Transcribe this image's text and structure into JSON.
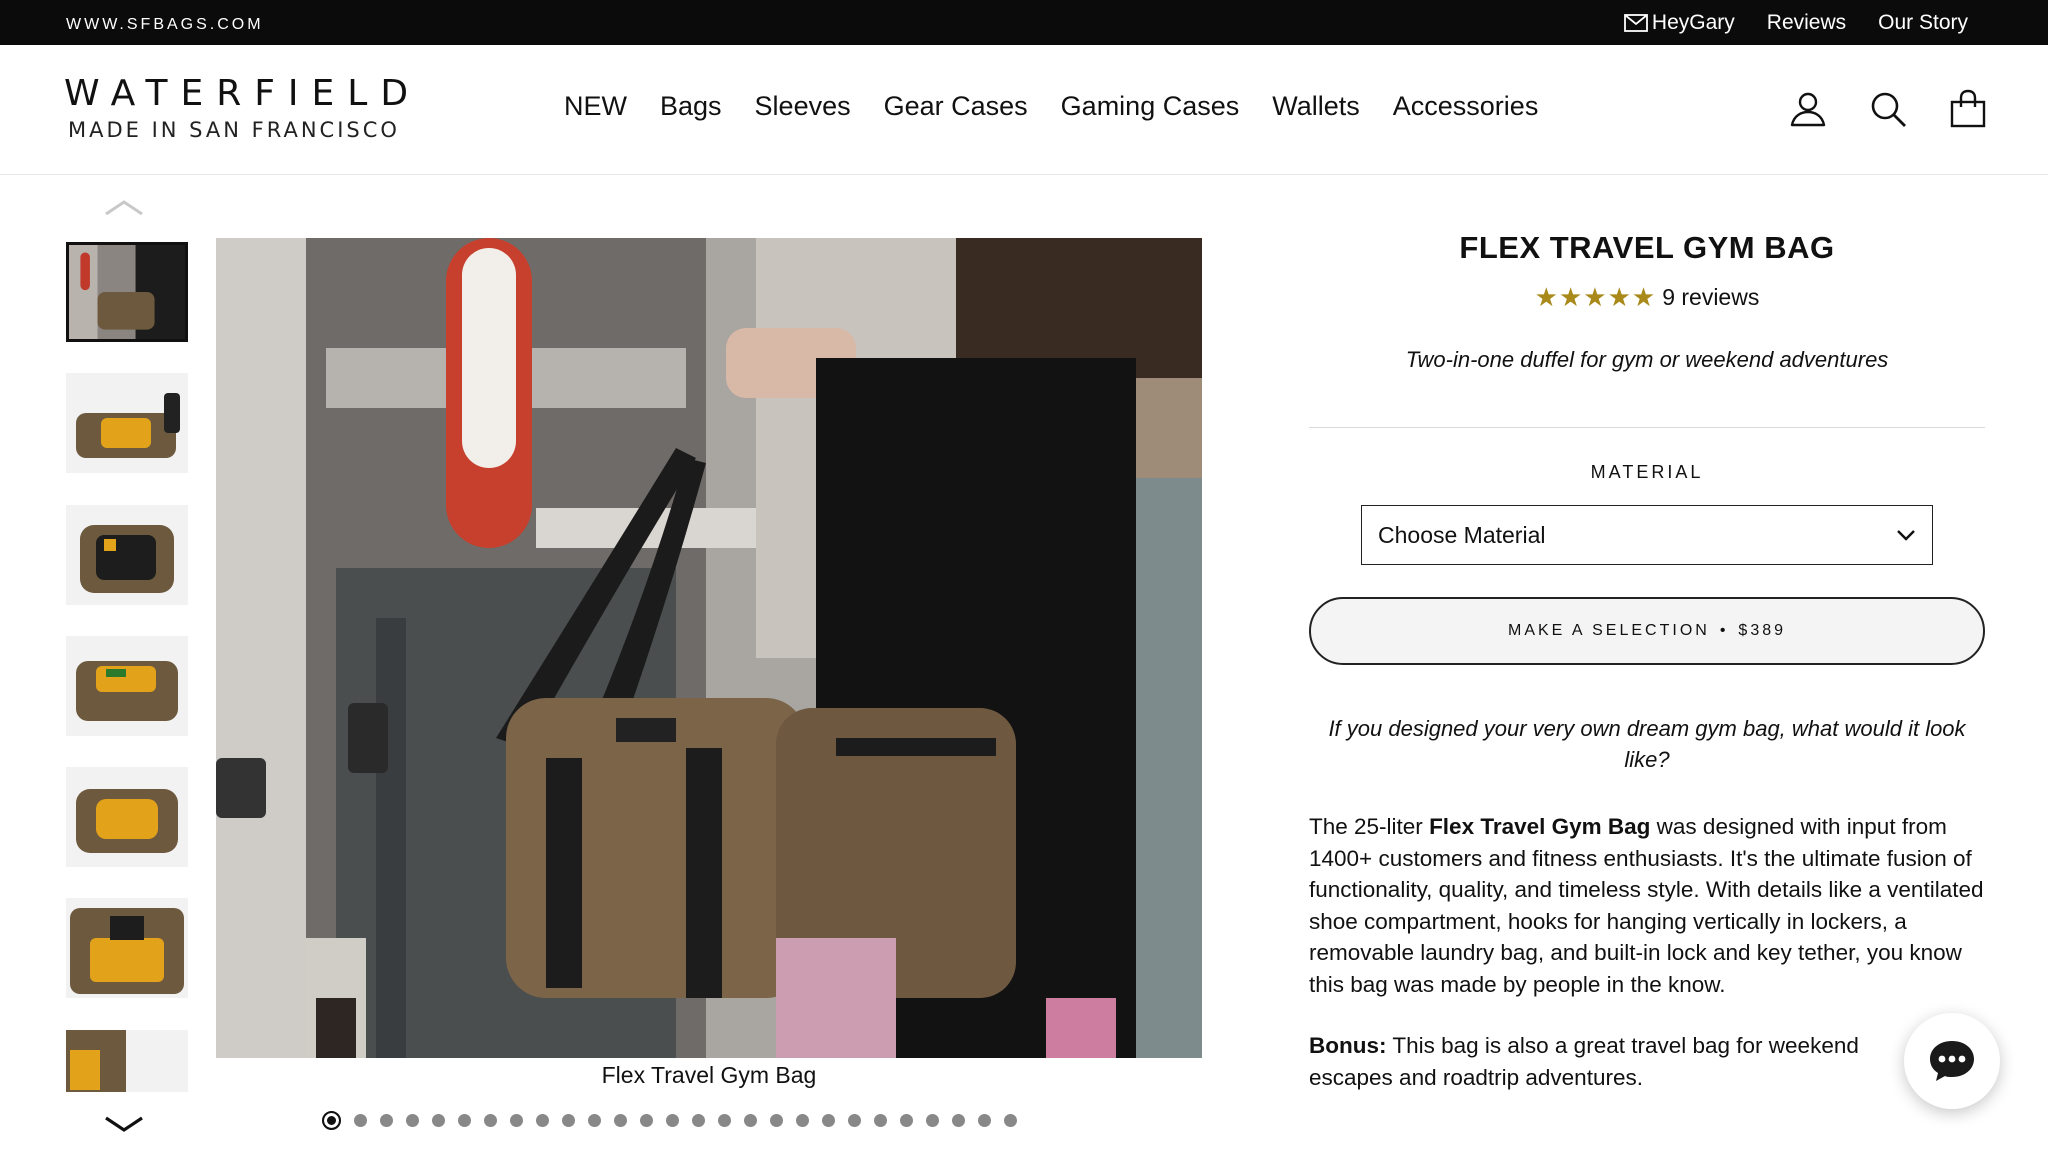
{
  "topbar": {
    "site": "WWW.SFBAGS.COM",
    "links": [
      "HeyGary",
      "Reviews",
      "Our Story"
    ]
  },
  "header": {
    "brand": "WATERFIELD",
    "tagline": "MADE IN SAN FRANCISCO",
    "nav": [
      "NEW",
      "Bags",
      "Sleeves",
      "Gear Cases",
      "Gaming Cases",
      "Wallets",
      "Accessories"
    ],
    "icons": [
      "account-icon",
      "search-icon",
      "cart-icon"
    ]
  },
  "gallery": {
    "thumb_count": 7,
    "active_thumb": 1,
    "caption": "Flex Travel Gym Bag",
    "dot_count": 27,
    "active_dot": 1
  },
  "product": {
    "title": "FLEX TRAVEL GYM BAG",
    "stars": "★★★★★",
    "rating_value": 5,
    "reviews": "9 reviews",
    "subtitle": "Two-in-one duffel for gym or weekend adventures",
    "material_label": "MATERIAL",
    "material_selected": "Choose Material",
    "button_label": "MAKE A SELECTION",
    "button_sep": "•",
    "price": "$389",
    "question": "If you designed your very own dream gym bag, what would it look like?",
    "desc_pre": "The 25-liter ",
    "desc_bold": "Flex Travel Gym Bag",
    "desc_post": " was designed with input from 1400+ customers and fitness enthusiasts. It's the ultimate fusion of functionality, quality, and timeless style. With details like a ventilated shoe compartment, hooks for hanging vertically in lockers, a removable laundry bag, and built-in lock and key tether, you know this bag was made by people in the know.",
    "bonus_label": "Bonus:",
    "bonus_text": " This bag is also a great travel bag for weekend escapes and roadtrip adventures."
  },
  "colors": {
    "star": "#a8891a",
    "topbar": "#0b0b0b"
  }
}
